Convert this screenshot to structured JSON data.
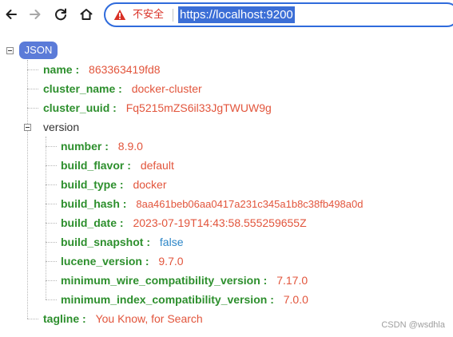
{
  "browser": {
    "back_icon": "arrow-left-icon",
    "forward_icon": "arrow-right-icon",
    "reload_icon": "reload-icon",
    "home_icon": "home-icon",
    "security_icon": "warning-triangle-icon",
    "security_label": "不安全",
    "url": "https://localhost:9200",
    "accent_color": "#2f6bdc",
    "warning_color": "#d93025"
  },
  "json_viewer": {
    "root_badge": "JSON",
    "colors": {
      "key": "#2d8f2d",
      "string_value": "#e2553c",
      "boolean_value": "#2c86c7",
      "badge": "#5b7bd8"
    },
    "fields": [
      {
        "key": "name",
        "colon": ":",
        "value": "863363419fd8"
      },
      {
        "key": "cluster_name",
        "colon": ":",
        "value": "docker-cluster"
      },
      {
        "key": "cluster_uuid",
        "colon": ":",
        "value": "Fq5215mZS6il33JgTWUW9g"
      }
    ],
    "version": {
      "key": "version",
      "fields": [
        {
          "key": "number",
          "colon": ":",
          "value": "8.9.0"
        },
        {
          "key": "build_flavor",
          "colon": ":",
          "value": "default"
        },
        {
          "key": "build_type",
          "colon": ":",
          "value": "docker"
        },
        {
          "key": "build_hash",
          "colon": ":",
          "value": "8aa461beb06aa0417a231c345a1b8c38fb498a0d"
        },
        {
          "key": "build_date",
          "colon": ":",
          "value": "2023-07-19T14:43:58.555259655Z"
        },
        {
          "key": "build_snapshot",
          "colon": ":",
          "value": "false"
        },
        {
          "key": "lucene_version",
          "colon": ":",
          "value": "9.7.0"
        },
        {
          "key": "minimum_wire_compatibility_version",
          "colon": ":",
          "value": "7.17.0"
        },
        {
          "key": "minimum_index_compatibility_version",
          "colon": ":",
          "value": "7.0.0"
        }
      ]
    },
    "tagline": {
      "key": "tagline",
      "colon": ":",
      "value": "You Know, for Search"
    }
  },
  "watermark": "CSDN @wsdhla"
}
